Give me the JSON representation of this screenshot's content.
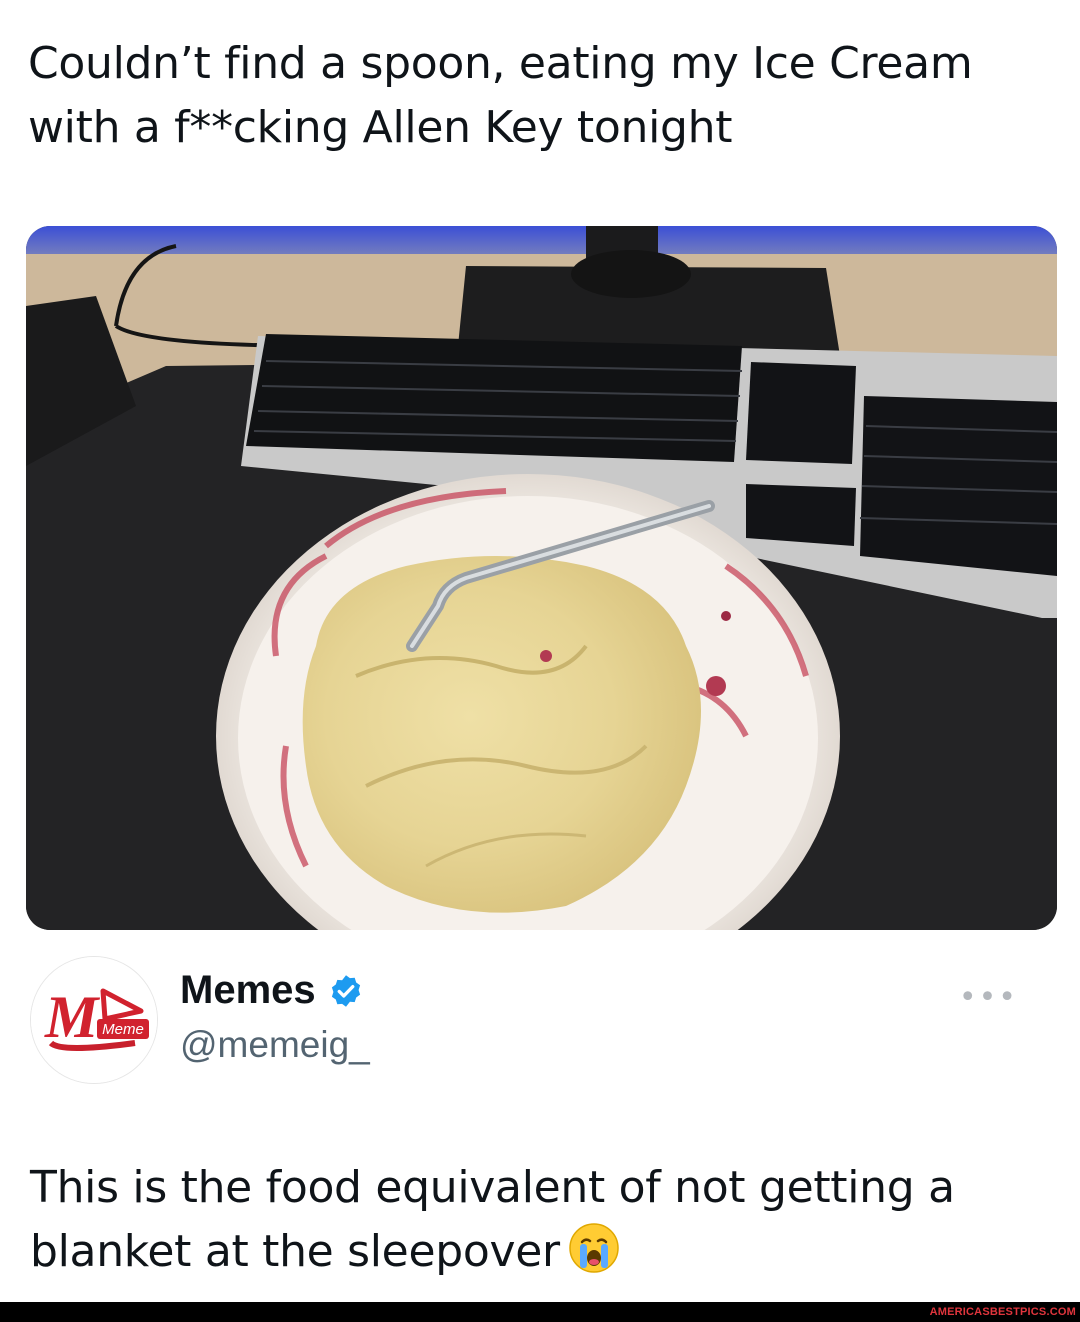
{
  "caption": {
    "line1": "Couldn’t find a spoon, eating my Ice Cream",
    "line2": "with a f**cking Allen Key tonight"
  },
  "photo": {
    "icon": "ice-cream-photo",
    "subject": "ice cream tub with allen key on desk"
  },
  "author": {
    "avatar_icon": "meme-logo-icon",
    "avatar_text": "Meme",
    "name": "Memes",
    "verified_icon": "verified-badge-icon",
    "handle": "@memeig_",
    "more_label": "•••"
  },
  "reply": {
    "line1": "This is the food equivalent of not getting a",
    "line2": "blanket at the sleepover",
    "emoji_icon": "crying-face-icon"
  },
  "watermark": "AMERICASBESTPICS.COM",
  "colors": {
    "text": "#0f1419",
    "handle": "#536471",
    "verified": "#1d9bf0",
    "watermark": "#e0353d"
  }
}
